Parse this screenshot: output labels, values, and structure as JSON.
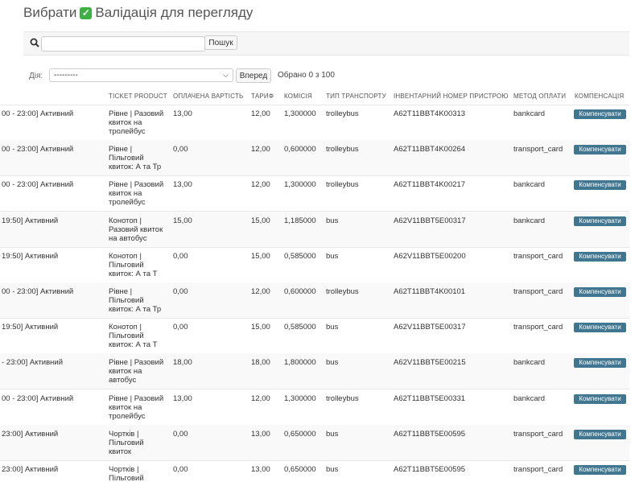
{
  "page": {
    "title_prefix": "Вибрати",
    "title_check": "✓",
    "title_suffix": "Валідація для перегляду"
  },
  "search": {
    "placeholder": "",
    "button": "Пошук",
    "icon": "search-icon"
  },
  "actions": {
    "label": "Дія:",
    "selected": "---------",
    "go_button": "Вперед",
    "counter": "Обрано 0 з 100"
  },
  "columns": [
    "Ticket product",
    "Оплачена вартість",
    "Тариф",
    "Комісія",
    "Тип транспорту",
    "Інвентарний номер пристрою",
    "Метод оплати",
    "Компенсація"
  ],
  "compensate_label": "Компенсувати",
  "rows": [
    {
      "status": "00 - 23:00] Активний",
      "product": "Рівне | Разовий квиток на тролейбус",
      "paid": "13,00",
      "tariff": "12,00",
      "commission": "1,300000",
      "transport": "trolleybus",
      "device": "A62T11BBT4K00313",
      "method": "bankcard"
    },
    {
      "status": "00 - 23:00] Активний",
      "product": "Рівне | Пільговий квиток: А та Тр",
      "paid": "0,00",
      "tariff": "12,00",
      "commission": "0,600000",
      "transport": "trolleybus",
      "device": "A62T11BBT4K00264",
      "method": "transport_card"
    },
    {
      "status": "00 - 23:00] Активний",
      "product": "Рівне | Разовий квиток на тролейбус",
      "paid": "13,00",
      "tariff": "12,00",
      "commission": "1,300000",
      "transport": "trolleybus",
      "device": "A62T11BBT4K00217",
      "method": "bankcard"
    },
    {
      "status": "19:50] Активний",
      "product": "Конотоп | Разовий квиток на автобус",
      "paid": "15,00",
      "tariff": "15,00",
      "commission": "1,185000",
      "transport": "bus",
      "device": "A62V11BBT5E00317",
      "method": "bankcard"
    },
    {
      "status": "19:50] Активний",
      "product": "Конотоп | Пільговий квиток: А та Т",
      "paid": "0,00",
      "tariff": "15,00",
      "commission": "0,585000",
      "transport": "bus",
      "device": "A62V11BBT5E00200",
      "method": "transport_card"
    },
    {
      "status": "00 - 23:00] Активний",
      "product": "Рівне | Пільговий квиток: А та Тр",
      "paid": "0,00",
      "tariff": "12,00",
      "commission": "0,600000",
      "transport": "trolleybus",
      "device": "A62T11BBT4K00101",
      "method": "transport_card"
    },
    {
      "status": "19:50] Активний",
      "product": "Конотоп | Пільговий квиток: А та Т",
      "paid": "0,00",
      "tariff": "15,00",
      "commission": "0,585000",
      "transport": "bus",
      "device": "A62V11BBT5E00317",
      "method": "transport_card"
    },
    {
      "status": "- 23:00] Активний",
      "product": "Рівне | Разовий квиток на автобус",
      "paid": "18,00",
      "tariff": "18,00",
      "commission": "1,800000",
      "transport": "bus",
      "device": "A62V11BBT5E00215",
      "method": "bankcard"
    },
    {
      "status": "00 - 23:00] Активний",
      "product": "Рівне | Разовий квиток на тролейбус",
      "paid": "13,00",
      "tariff": "12,00",
      "commission": "1,300000",
      "transport": "trolleybus",
      "device": "A62T11BBT5E00331",
      "method": "bankcard"
    },
    {
      "status": "23:00] Активний",
      "product": "Чортків | Пільговий квиток",
      "paid": "0,00",
      "tariff": "13,00",
      "commission": "0,650000",
      "transport": "bus",
      "device": "A62T11BBT5E00595",
      "method": "transport_card"
    },
    {
      "status": "23:00] Активний",
      "product": "Чортків | Пільговий",
      "paid": "0,00",
      "tariff": "13,00",
      "commission": "0,650000",
      "transport": "bus",
      "device": "A62T11BBT5E00595",
      "method": "transport_card"
    }
  ]
}
